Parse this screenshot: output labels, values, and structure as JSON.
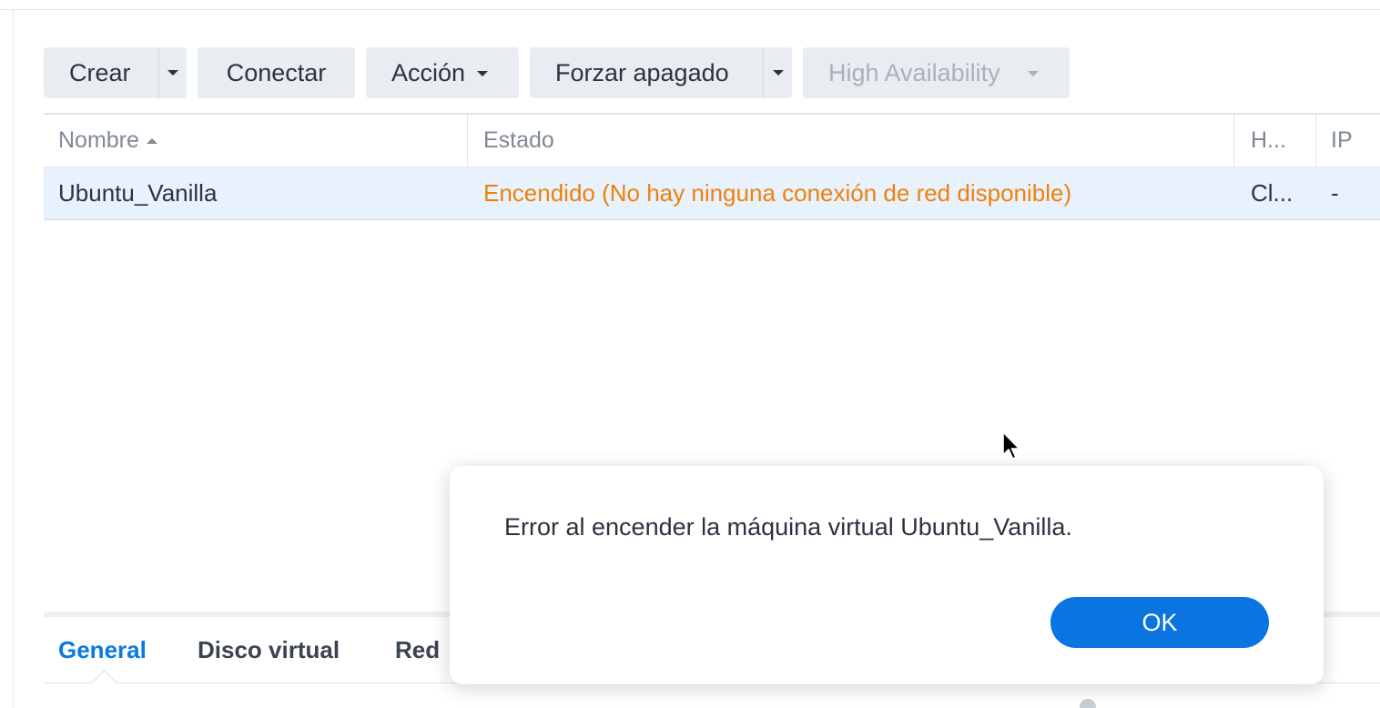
{
  "toolbar": {
    "create_label": "Crear",
    "connect_label": "Conectar",
    "action_label": "Acción",
    "force_shutdown_label": "Forzar apagado",
    "high_availability_label": "High Availability"
  },
  "grid": {
    "columns": [
      {
        "label": "Nombre",
        "sort": "ascending"
      },
      {
        "label": "Estado"
      },
      {
        "label": "H..."
      },
      {
        "label": "IP"
      }
    ],
    "rows": [
      {
        "name": "Ubuntu_Vanilla",
        "status": "Encendido (No hay ninguna conexión de red disponible)",
        "host": "Cl...",
        "ip": "-"
      }
    ]
  },
  "tabs": [
    {
      "label": "General",
      "active": true
    },
    {
      "label": "Disco virtual"
    },
    {
      "label": "Red"
    }
  ],
  "dialog": {
    "message": "Error al encender la máquina virtual Ubuntu_Vanilla.",
    "ok_label": "OK"
  },
  "colors": {
    "accent": "#0a74e0",
    "status_warning": "#f0800a",
    "selected_row": "#e8f2fd"
  }
}
